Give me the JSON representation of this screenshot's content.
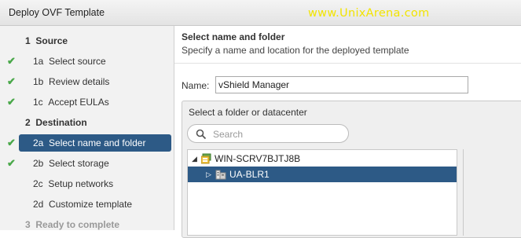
{
  "window": {
    "title": "Deploy OVF Template",
    "watermark": "www.UnixArena.com"
  },
  "steps": [
    {
      "number": "1",
      "label": "Source",
      "completed": false,
      "section": true
    },
    {
      "number": "1a",
      "label": "Select source",
      "completed": true
    },
    {
      "number": "1b",
      "label": "Review details",
      "completed": true
    },
    {
      "number": "1c",
      "label": "Accept EULAs",
      "completed": true
    },
    {
      "number": "2",
      "label": "Destination",
      "completed": false,
      "section": true
    },
    {
      "number": "2a",
      "label": "Select name and folder",
      "completed": true,
      "active": true
    },
    {
      "number": "2b",
      "label": "Select storage",
      "completed": true
    },
    {
      "number": "2c",
      "label": "Setup networks",
      "completed": false
    },
    {
      "number": "2d",
      "label": "Customize template",
      "completed": false
    },
    {
      "number": "3",
      "label": "Ready to complete",
      "completed": false,
      "section": true,
      "disabled": true
    }
  ],
  "content": {
    "heading": "Select name and folder",
    "subheading": "Specify a name and location for the deployed template",
    "name_label": "Name:",
    "name_value": "vShield Manager",
    "folder_label": "Select a folder or datacenter",
    "search_placeholder": "Search",
    "tree": [
      {
        "label": "WIN-SCRV7BJTJ8B",
        "expanded": true,
        "icon": "vcenter-icon",
        "selected": false
      },
      {
        "label": "UA-BLR1",
        "expanded": false,
        "icon": "datacenter-icon",
        "selected": true
      }
    ]
  },
  "colors": {
    "accent": "#2d5a86",
    "check": "#4aa84a",
    "watermark": "#f2e400"
  }
}
